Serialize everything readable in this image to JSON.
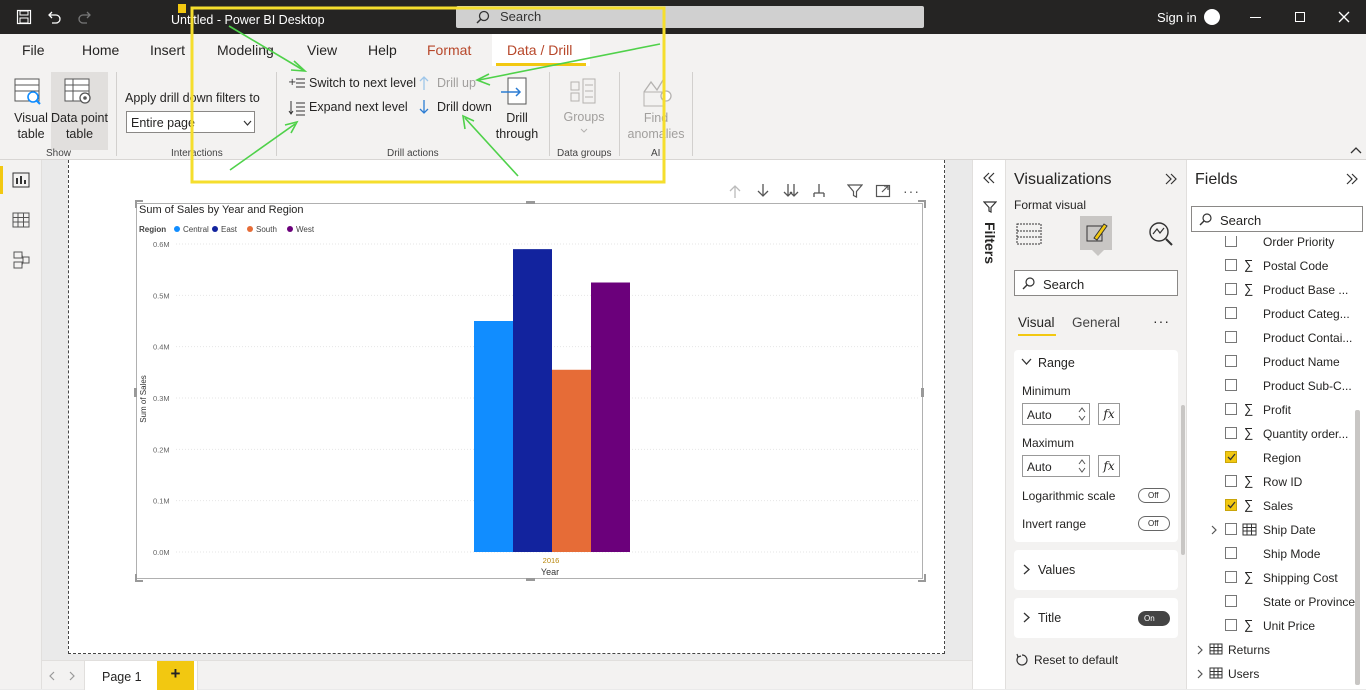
{
  "titlebar": {
    "title": "Untitled - Power BI Desktop",
    "search": "Search",
    "signin": "Sign in"
  },
  "tabs": [
    "File",
    "Home",
    "Insert",
    "Modeling",
    "View",
    "Help",
    "Format",
    "Data / Drill"
  ],
  "ribbon": {
    "visual_table": "Visual table",
    "data_point_table": "Data point table",
    "show": "Show",
    "apply_filters": "Apply drill down filters to",
    "apply_value": "Entire page",
    "interactions": "Interactions",
    "switch_next": "Switch to next level",
    "expand_next": "Expand next level",
    "drill_up": "Drill up",
    "drill_down": "Drill down",
    "drill_through": "Drill through",
    "drill_actions": "Drill actions",
    "groups": "Groups",
    "data_groups": "Data groups",
    "find_anomalies": "Find anomalies",
    "ai": "AI"
  },
  "chart_data": {
    "type": "bar",
    "title": "Sum of Sales by Year and Region",
    "legend_title": "Region",
    "categories": [
      "2016"
    ],
    "series": [
      {
        "name": "Central",
        "values": [
          0.45
        ],
        "color": "#118dff"
      },
      {
        "name": "East",
        "values": [
          0.59
        ],
        "color": "#12239e"
      },
      {
        "name": "South",
        "values": [
          0.355
        ],
        "color": "#e66c37"
      },
      {
        "name": "West",
        "values": [
          0.525
        ],
        "color": "#6b007b"
      }
    ],
    "ylabel": "Sum of Sales",
    "xlabel": "Year",
    "ylim": [
      0,
      0.6
    ],
    "yticks": [
      "0.0M",
      "0.1M",
      "0.2M",
      "0.3M",
      "0.4M",
      "0.5M",
      "0.6M"
    ],
    "unit": "M",
    "legend_position": "top-left",
    "grid": true
  },
  "filters": {
    "label": "Filters"
  },
  "visualizations": {
    "title": "Visualizations",
    "format_visual": "Format visual",
    "search": "Search",
    "tab_visual": "Visual",
    "tab_general": "General",
    "range": "Range",
    "minimum": "Minimum",
    "min_value": "Auto",
    "maximum": "Maximum",
    "max_value": "Auto",
    "fx": "fx",
    "log_scale": "Logarithmic scale",
    "log_toggle": "Off",
    "invert": "Invert range",
    "invert_toggle": "Off",
    "values": "Values",
    "title_section": "Title",
    "title_toggle": "On",
    "reset": "Reset to default"
  },
  "fields": {
    "title": "Fields",
    "search": "Search",
    "items": [
      {
        "label": "Order Priority",
        "sigma": false,
        "checked": false
      },
      {
        "label": "Postal Code",
        "sigma": true,
        "checked": false
      },
      {
        "label": "Product Base ...",
        "sigma": true,
        "checked": false
      },
      {
        "label": "Product Categ...",
        "sigma": false,
        "checked": false
      },
      {
        "label": "Product Contai...",
        "sigma": false,
        "checked": false
      },
      {
        "label": "Product Name",
        "sigma": false,
        "checked": false
      },
      {
        "label": "Product Sub-C...",
        "sigma": false,
        "checked": false
      },
      {
        "label": "Profit",
        "sigma": true,
        "checked": false
      },
      {
        "label": "Quantity order...",
        "sigma": true,
        "checked": false
      },
      {
        "label": "Region",
        "sigma": false,
        "checked": true
      },
      {
        "label": "Row ID",
        "sigma": true,
        "checked": false
      },
      {
        "label": "Sales",
        "sigma": true,
        "checked": true
      },
      {
        "label": "Ship Date",
        "sigma": false,
        "checked": false,
        "table_icon": true,
        "expand": true
      },
      {
        "label": "Ship Mode",
        "sigma": false,
        "checked": false
      },
      {
        "label": "Shipping Cost",
        "sigma": true,
        "checked": false
      },
      {
        "label": "State or Province",
        "sigma": false,
        "checked": false
      },
      {
        "label": "Unit Price",
        "sigma": true,
        "checked": false
      }
    ],
    "tables": [
      "Returns",
      "Users"
    ]
  },
  "pages": {
    "page1": "Page 1",
    "add": "+"
  },
  "colors": {
    "accent": "#f2c811",
    "highlight_box": "#f5de2d",
    "arrow": "#4fd14a"
  }
}
